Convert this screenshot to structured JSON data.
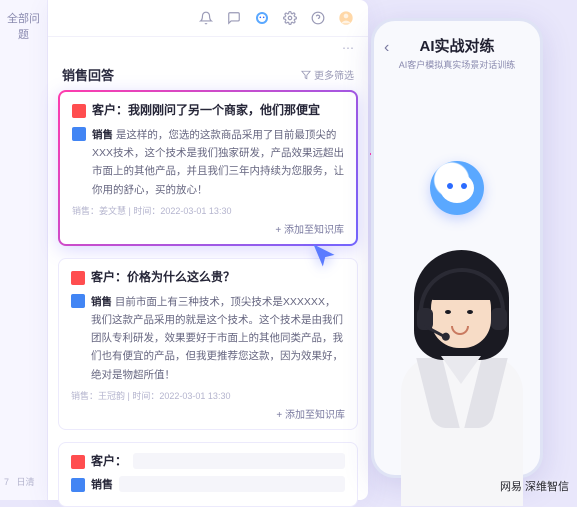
{
  "sidebar": {
    "items": [
      {
        "label": "全部问题"
      }
    ],
    "stats_prefix": "7",
    "stats_suffix": "日清"
  },
  "topIcons": {
    "bell": "bell-icon",
    "msg": "message-icon",
    "bot": "bot-icon",
    "gear": "gear-icon",
    "help": "help-icon",
    "avatar": "avatar-icon"
  },
  "panel": {
    "title": "销售回答",
    "filter": "更多筛选",
    "moreIcon": "⋯"
  },
  "cards": [
    {
      "customer_label": "客户：",
      "customer_text": "我刚刚问了另一个商家，他们那便宜",
      "sale_label": "销售",
      "sale_text": "是这样的，您选的这款商品采用了目前最顶尖的XXX技术，这个技术是我们独家研发，产品效果远超出市面上的其他产品，并且我们三年内持续为您服务，让你用的舒心，买的放心！",
      "meta_prefix": "销售：",
      "meta_author": "姜文慧",
      "meta_time_label": "时间：",
      "meta_time": "2022-03-01 13:30",
      "add_label": "+ 添加至知识库"
    },
    {
      "customer_label": "客户：",
      "customer_text": "价格为什么这么贵？",
      "sale_label": "销售",
      "sale_text": "目前市面上有三种技术，顶尖技术是XXXXXX，我们这款产品采用的就是这个技术。这个技术是由我们团队专利研发，效果要好于市面上的其他同类产品，我们也有便宜的产品，但我更推荐您这款，因为效果好，绝对是物超所值！",
      "meta_prefix": "销售：",
      "meta_author": "王冠韵",
      "meta_time_label": "时间：",
      "meta_time": "2022-03-01 13:30",
      "add_label": "+ 添加至知识库"
    }
  ],
  "compose": {
    "customer_label": "客户：",
    "sale_label": "销售"
  },
  "phone": {
    "title": "AI实战对练",
    "subtitle": "AI客户模拟真实场景对话训练",
    "back": "‹"
  },
  "watermark": "网易    深维智信"
}
